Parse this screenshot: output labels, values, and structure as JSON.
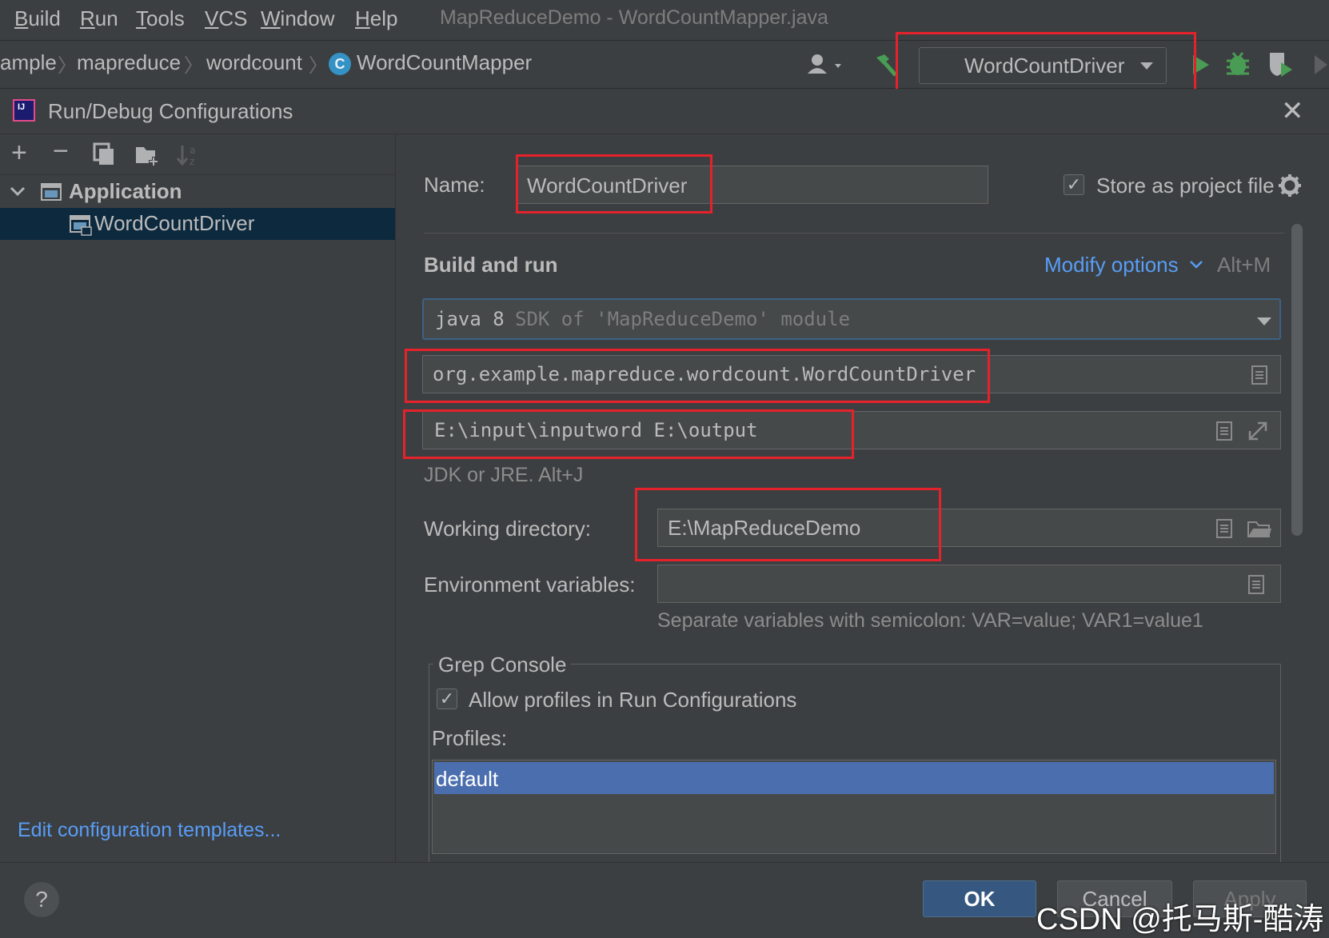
{
  "menu": {
    "items": [
      "Build",
      "Run",
      "Tools",
      "VCS",
      "Window",
      "Help"
    ],
    "window_title": "MapReduceDemo - WordCountMapper.java"
  },
  "breadcrumbs": [
    "ample",
    "mapreduce",
    "wordcount",
    "WordCountMapper"
  ],
  "toolbar": {
    "run_config": "WordCountDriver"
  },
  "dialog": {
    "title": "Run/Debug Configurations",
    "tree": {
      "group": "Application",
      "item": "WordCountDriver"
    },
    "edit_templates_link": "Edit configuration templates...",
    "name_label": "Name:",
    "name_value": "WordCountDriver",
    "store_as_project_file": "Store as project file",
    "section_title": "Build and run",
    "modify_options": "Modify options",
    "modify_options_shortcut": "Alt+M",
    "jdk": {
      "main": "java 8",
      "detail": "SDK of 'MapReduceDemo' module"
    },
    "main_class": "org.example.mapreduce.wordcount.WordCountDriver",
    "program_args": "E:\\input\\inputword E:\\output",
    "jdk_hint": "JDK or JRE. Alt+J",
    "working_dir_label": "Working directory:",
    "working_dir_value": "E:\\MapReduceDemo",
    "env_label": "Environment variables:",
    "env_value": "",
    "env_hint": "Separate variables with semicolon: VAR=value; VAR1=value1",
    "grep_console": {
      "title": "Grep Console",
      "allow_profiles": "Allow profiles in Run Configurations",
      "profiles_label": "Profiles:",
      "profiles": [
        "default"
      ]
    },
    "buttons": {
      "ok": "OK",
      "cancel": "Cancel",
      "apply": "Apply"
    },
    "help": "?"
  },
  "watermark": "CSDN @托马斯-酷涛",
  "colors": {
    "background": "#3c3f41",
    "link": "#589df6",
    "selection": "#4b6eaf",
    "highlight_box": "#e5222b",
    "run_green": "#499c54"
  }
}
